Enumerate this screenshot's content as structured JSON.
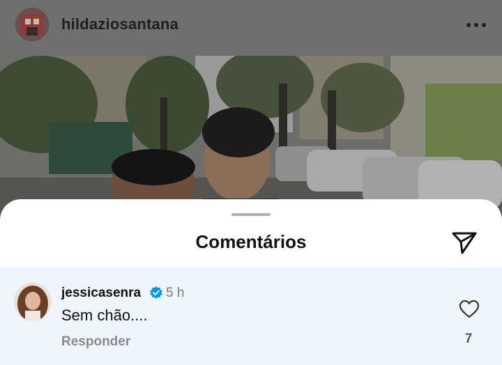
{
  "post": {
    "username": "hildaziosantana",
    "more_icon": "more-horizontal-icon"
  },
  "comments_sheet": {
    "title": "Comentários",
    "send_icon": "send-icon"
  },
  "comment": {
    "username": "jessicasenra",
    "verified": true,
    "time": "5 h",
    "text": "Sem chão....",
    "reply_label": "Responder",
    "likes": "7"
  },
  "colors": {
    "verified_blue": "#0095f6",
    "comment_bg": "#eef5fb"
  }
}
